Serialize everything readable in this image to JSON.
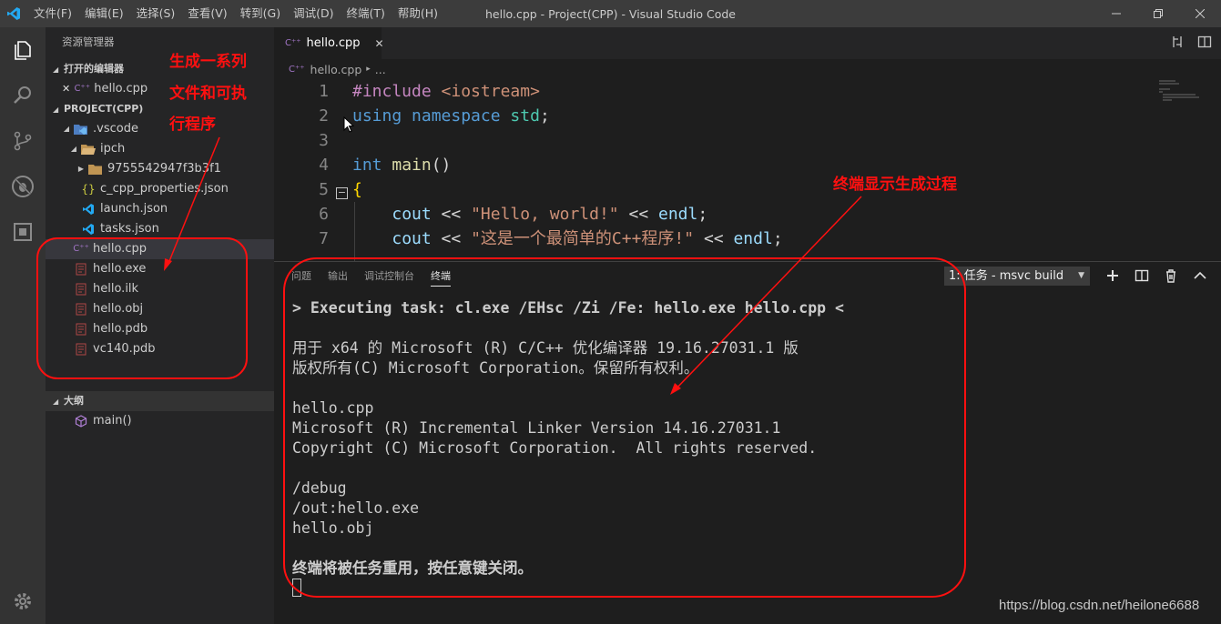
{
  "titlebar": {
    "menu": [
      "文件(F)",
      "编辑(E)",
      "选择(S)",
      "查看(V)",
      "转到(G)",
      "调试(D)",
      "终端(T)",
      "帮助(H)"
    ],
    "window_title": "hello.cpp - Project(CPP) - Visual Studio Code"
  },
  "activity": {
    "icons": [
      "files-icon",
      "search-icon",
      "source-control-icon",
      "debug-icon",
      "extensions-icon",
      "settings-gear-icon"
    ]
  },
  "sidebar": {
    "title": "资源管理器",
    "open_editors": {
      "header": "打开的编辑器",
      "items": [
        {
          "close": "✕",
          "label": "hello.cpp"
        }
      ]
    },
    "project": {
      "header": "PROJECT(CPP)",
      "vscode_folder": ".vscode",
      "ipch_folder": "ipch",
      "hash_folder": "9755542947f3b3f1",
      "files_in_vscode": [
        "c_cpp_properties.json",
        "launch.json",
        "tasks.json"
      ],
      "root_files": [
        "hello.cpp",
        "hello.exe",
        "hello.ilk",
        "hello.obj",
        "hello.pdb",
        "vc140.pdb"
      ]
    },
    "outline": {
      "header": "大纲",
      "item": "main()"
    }
  },
  "editor": {
    "tab_label": "hello.cpp",
    "breadcrumb": "hello.cpp",
    "breadcrumb_more": "...",
    "lines": [
      {
        "n": "1",
        "parts": [
          [
            "k-pre",
            "#include"
          ],
          [
            "k-plain",
            " "
          ],
          [
            "k-inc",
            "<iostream>"
          ]
        ]
      },
      {
        "n": "2",
        "parts": [
          [
            "k-kw",
            "using"
          ],
          [
            "k-plain",
            " "
          ],
          [
            "k-kw",
            "namespace"
          ],
          [
            "k-plain",
            " "
          ],
          [
            "k-ns",
            "std"
          ],
          [
            "k-plain",
            ";"
          ]
        ]
      },
      {
        "n": "3",
        "parts": []
      },
      {
        "n": "4",
        "parts": [
          [
            "k-kw",
            "int"
          ],
          [
            "k-plain",
            " "
          ],
          [
            "k-fn",
            "main"
          ],
          [
            "k-plain",
            "()"
          ]
        ]
      },
      {
        "n": "5",
        "parts": [
          [
            "k-brace",
            "{"
          ]
        ]
      },
      {
        "n": "6",
        "parts": [
          [
            "k-plain",
            "    "
          ],
          [
            "k-var",
            "cout"
          ],
          [
            "k-plain",
            " << "
          ],
          [
            "k-str",
            "\"Hello, world!\""
          ],
          [
            "k-plain",
            " << "
          ],
          [
            "k-var",
            "endl"
          ],
          [
            "k-plain",
            ";"
          ]
        ]
      },
      {
        "n": "7",
        "parts": [
          [
            "k-plain",
            "    "
          ],
          [
            "k-var",
            "cout"
          ],
          [
            "k-plain",
            " << "
          ],
          [
            "k-str",
            "\"这是一个最简单的C++程序!\""
          ],
          [
            "k-plain",
            " << "
          ],
          [
            "k-var",
            "endl"
          ],
          [
            "k-plain",
            ";"
          ]
        ]
      }
    ]
  },
  "panel": {
    "tabs": [
      "问题",
      "输出",
      "调试控制台",
      "终端"
    ],
    "active_tab": "终端",
    "task_select": "1: 任务 - msvc build",
    "terminal_lines": [
      {
        "text": "> Executing task: cl.exe /EHsc /Zi /Fe: hello.exe hello.cpp <",
        "bold": true
      },
      {
        "text": "",
        "bold": false
      },
      {
        "text": "用于 x64 的 Microsoft (R) C/C++ 优化编译器 19.16.27031.1 版",
        "bold": false
      },
      {
        "text": "版权所有(C) Microsoft Corporation。保留所有权利。",
        "bold": false
      },
      {
        "text": "",
        "bold": false
      },
      {
        "text": "hello.cpp",
        "bold": false
      },
      {
        "text": "Microsoft (R) Incremental Linker Version 14.16.27031.1",
        "bold": false
      },
      {
        "text": "Copyright (C) Microsoft Corporation.  All rights reserved.",
        "bold": false
      },
      {
        "text": "",
        "bold": false
      },
      {
        "text": "/debug",
        "bold": false
      },
      {
        "text": "/out:hello.exe",
        "bold": false
      },
      {
        "text": "hello.obj",
        "bold": false
      },
      {
        "text": "",
        "bold": false
      },
      {
        "text": "终端将被任务重用，按任意键关闭。",
        "bold": true
      }
    ]
  },
  "annotations": {
    "left_note": [
      "生成一系列",
      "文件和可执",
      "行程序"
    ],
    "right_note": "终端显示生成过程",
    "color": "#ff1010"
  },
  "watermark": "https://blog.csdn.net/heilone6688"
}
